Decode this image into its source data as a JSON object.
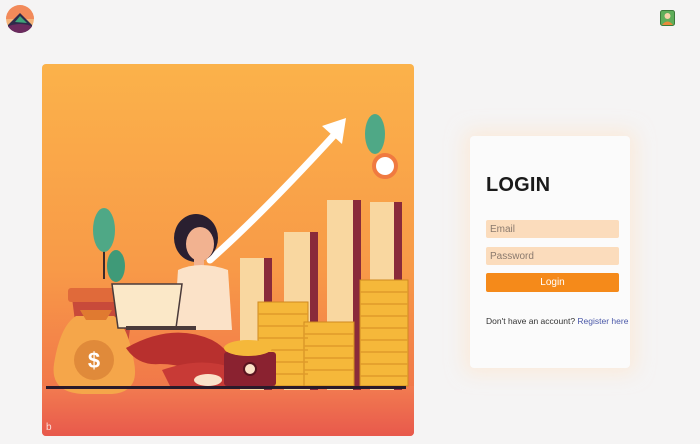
{
  "app": {
    "logo_icon": "mountain-logo-icon",
    "account_icon": "user-account-icon"
  },
  "hero": {
    "illustration": "woman-with-laptop-coins-growth-chart"
  },
  "login": {
    "title": "LOGIN",
    "email_placeholder": "Email",
    "password_placeholder": "Password",
    "button_label": "Login",
    "register_prompt": "Don't have an account?",
    "register_link": "Register here"
  },
  "colors": {
    "accent": "#f58a1a",
    "input_bg": "#fbdcbc",
    "link": "#4a58a8",
    "page_bg": "#f5f4f4"
  }
}
